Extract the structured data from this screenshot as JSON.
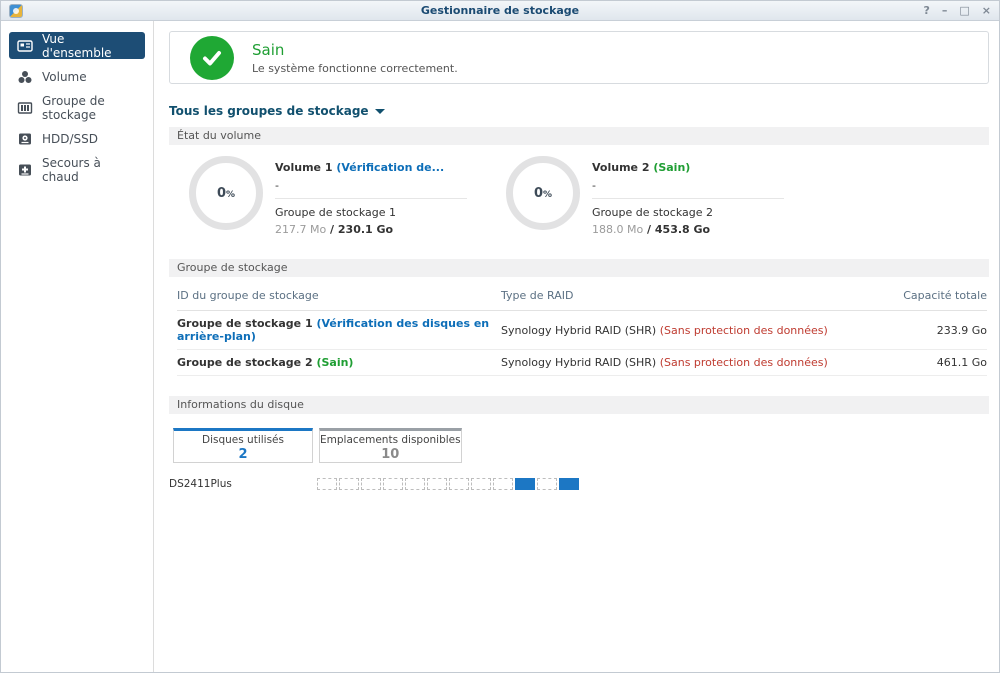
{
  "colors": {
    "accent_blue": "#1c77c4",
    "selected_navy": "#1d4d75",
    "status_green": "#1f9e33",
    "status_blue": "#0d6eb8",
    "warning_red": "#bf3b30"
  },
  "window": {
    "title": "Gestionnaire de stockage",
    "app_icon": "storage-manager-app-icon",
    "controls": [
      {
        "name": "help",
        "glyph": "?"
      },
      {
        "name": "minimize",
        "glyph": "–"
      },
      {
        "name": "maximize",
        "glyph": "□"
      },
      {
        "name": "close",
        "glyph": "×"
      }
    ]
  },
  "sidebar": {
    "items": [
      {
        "label": "Vue d'ensemble",
        "icon": "overview-icon",
        "selected": true
      },
      {
        "label": "Volume",
        "icon": "volume-icon",
        "selected": false
      },
      {
        "label": "Groupe de stockage",
        "icon": "storage-pool-icon",
        "selected": false
      },
      {
        "label": "HDD/SSD",
        "icon": "hdd-icon",
        "selected": false
      },
      {
        "label": "Secours à chaud",
        "icon": "hot-spare-icon",
        "selected": false
      }
    ]
  },
  "health": {
    "status": "Sain",
    "description": "Le système fonctionne correctement.",
    "icon": "green-check-icon"
  },
  "pool_filter": {
    "label": "Tous les groupes de stockage"
  },
  "volume_section": {
    "title": "État du volume",
    "volumes": [
      {
        "percent": "0",
        "percent_unit": "%",
        "name": "Volume 1 ",
        "status": "(Vérification de...",
        "status_color": "#0d6eb8",
        "placeholder": "-",
        "pool": "Groupe de stockage 1",
        "used": "217.7 Mo",
        "separator": " / ",
        "total": "230.1 Go"
      },
      {
        "percent": "0",
        "percent_unit": "%",
        "name": "Volume 2 ",
        "status": "(Sain)",
        "status_color": "#1f9e33",
        "placeholder": "-",
        "pool": "Groupe de stockage 2",
        "used": "188.0 Mo",
        "separator": " / ",
        "total": "453.8 Go"
      }
    ]
  },
  "pool_section": {
    "title": "Groupe de stockage",
    "columns": [
      "ID du groupe de stockage",
      "Type de RAID",
      "Capacité totale"
    ],
    "rows": [
      {
        "name": "Groupe de stockage 1 ",
        "status": "(Vérification des disques en arrière-plan)",
        "status_color": "#0d6eb8",
        "raid": "Synology Hybrid RAID (SHR) ",
        "raid_warning": "(Sans protection des données)",
        "warning_color": "#bf3b30",
        "capacity": "233.9 Go"
      },
      {
        "name": "Groupe de stockage 2 ",
        "status": "(Sain)",
        "status_color": "#1f9e33",
        "raid": "Synology Hybrid RAID (SHR) ",
        "raid_warning": "(Sans protection des données)",
        "warning_color": "#bf3b30",
        "capacity": "461.1 Go"
      }
    ]
  },
  "disk_section": {
    "title": "Informations du disque",
    "tabs": [
      {
        "label": "Disques utilisés",
        "count": "2",
        "active": true
      },
      {
        "label": "Emplacements disponibles",
        "count": "10",
        "active": false
      }
    ],
    "device": {
      "name": "DS2411Plus",
      "slots": [
        "empty",
        "empty",
        "empty",
        "empty",
        "empty",
        "empty",
        "empty",
        "empty",
        "empty",
        "used",
        "empty",
        "used"
      ]
    }
  }
}
